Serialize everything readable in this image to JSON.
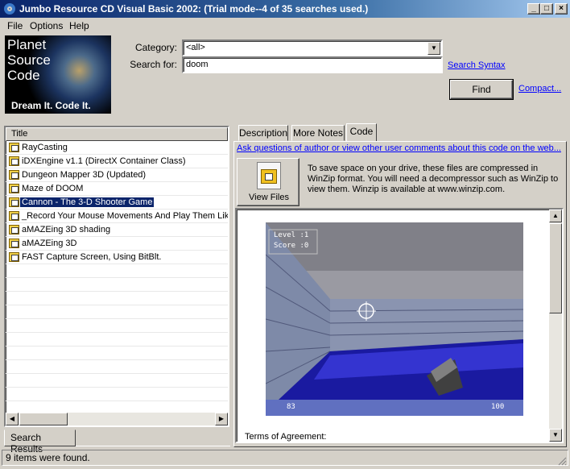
{
  "window": {
    "title": "Jumbo Resource CD Visual Basic 2002: (Trial mode--4 of 35 searches used.)",
    "minimize": "_",
    "maximize": "□",
    "close": "×"
  },
  "menu": [
    "File",
    "Options",
    "Help"
  ],
  "logo": {
    "line1": "Planet",
    "line2": "Source",
    "line3": "Code",
    "tagline": "Dream It.  Code It."
  },
  "search": {
    "category_label": "Category:",
    "category_value": "<all>",
    "search_label": "Search for:",
    "search_value": "doom",
    "syntax_link": "Search Syntax",
    "find_button": "Find",
    "compact_link": "Compact..."
  },
  "results": {
    "column_title": "Title",
    "rows": [
      "RayCasting",
      "iDXEngine v1.1 (DirectX Container Class)",
      "Dungeon Mapper 3D (Updated)",
      "Maze of DOOM",
      "Cannon - The 3-D Shooter Game",
      "_Record Your Mouse Movements And Play Them Like",
      "aMAZEing 3D shading",
      "aMAZEing 3D",
      "FAST Capture Screen, Using BitBlt."
    ],
    "selected_index": 4,
    "bottom_tab": "Search Results"
  },
  "detail": {
    "tabs": [
      "Description",
      "More Notes",
      "Code"
    ],
    "active_tab": "Code",
    "ask_link": "Ask questions of author or view other user comments about this code on the web...",
    "view_files_label": "View Files",
    "winzip_note": "To save space on your drive, these files are compressed in WinZip format.  You will need a decompressor such as WinZip to view them.  Winzip is available at www.winzip.com.",
    "game_level": "Level :1",
    "game_score": "Score :0",
    "game_ammo": "83",
    "game_health": "100",
    "terms_heading": "Terms of Agreement:"
  },
  "status": "9 items were found."
}
